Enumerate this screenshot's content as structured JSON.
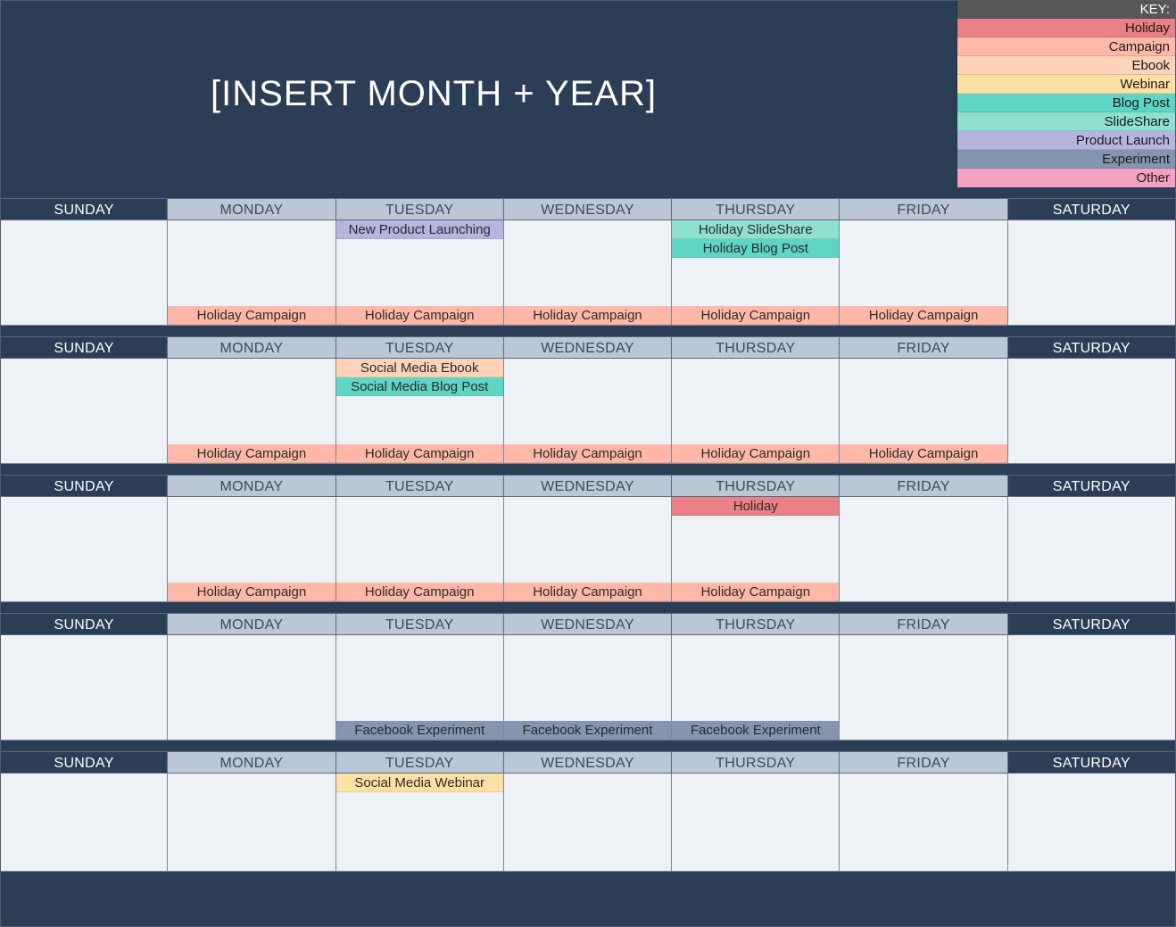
{
  "title": "[INSERT MONTH + YEAR]",
  "key_header": "KEY:",
  "legend": [
    {
      "label": "Holiday",
      "cls": "legend-holiday"
    },
    {
      "label": "Campaign",
      "cls": "legend-campaign"
    },
    {
      "label": "Ebook",
      "cls": "legend-ebook"
    },
    {
      "label": "Webinar",
      "cls": "legend-webinar"
    },
    {
      "label": "Blog Post",
      "cls": "legend-blogpost"
    },
    {
      "label": "SlideShare",
      "cls": "legend-slideshare"
    },
    {
      "label": "Product Launch",
      "cls": "legend-productlaunch"
    },
    {
      "label": "Experiment",
      "cls": "legend-experiment"
    },
    {
      "label": "Other",
      "cls": "legend-other"
    }
  ],
  "day_headers": [
    "SUNDAY",
    "MONDAY",
    "TUESDAY",
    "WEDNESDAY",
    "THURSDAY",
    "FRIDAY",
    "SATURDAY"
  ],
  "weeks": [
    {
      "days": [
        {
          "top": [],
          "bottom": []
        },
        {
          "top": [],
          "bottom": [
            {
              "label": "Holiday Campaign",
              "cls": "ev-campaign"
            }
          ]
        },
        {
          "top": [
            {
              "label": "New Product Launching",
              "cls": "ev-productlaunch"
            }
          ],
          "bottom": [
            {
              "label": "Holiday Campaign",
              "cls": "ev-campaign"
            }
          ]
        },
        {
          "top": [],
          "bottom": [
            {
              "label": "Holiday Campaign",
              "cls": "ev-campaign"
            }
          ]
        },
        {
          "top": [
            {
              "label": "Holiday SlideShare",
              "cls": "ev-slideshare"
            },
            {
              "label": "Holiday Blog Post",
              "cls": "ev-blogpost"
            }
          ],
          "bottom": [
            {
              "label": "Holiday Campaign",
              "cls": "ev-campaign"
            }
          ]
        },
        {
          "top": [],
          "bottom": [
            {
              "label": "Holiday Campaign",
              "cls": "ev-campaign"
            }
          ]
        },
        {
          "top": [],
          "bottom": []
        }
      ]
    },
    {
      "days": [
        {
          "top": [],
          "bottom": []
        },
        {
          "top": [],
          "bottom": [
            {
              "label": "Holiday Campaign",
              "cls": "ev-campaign"
            }
          ]
        },
        {
          "top": [
            {
              "label": "Social Media Ebook",
              "cls": "ev-ebook"
            },
            {
              "label": "Social Media Blog Post",
              "cls": "ev-blogpost"
            }
          ],
          "bottom": [
            {
              "label": "Holiday Campaign",
              "cls": "ev-campaign"
            }
          ]
        },
        {
          "top": [],
          "bottom": [
            {
              "label": "Holiday Campaign",
              "cls": "ev-campaign"
            }
          ]
        },
        {
          "top": [],
          "bottom": [
            {
              "label": "Holiday Campaign",
              "cls": "ev-campaign"
            }
          ]
        },
        {
          "top": [],
          "bottom": [
            {
              "label": "Holiday Campaign",
              "cls": "ev-campaign"
            }
          ]
        },
        {
          "top": [],
          "bottom": []
        }
      ]
    },
    {
      "days": [
        {
          "top": [],
          "bottom": []
        },
        {
          "top": [],
          "bottom": [
            {
              "label": "Holiday Campaign",
              "cls": "ev-campaign"
            }
          ]
        },
        {
          "top": [],
          "bottom": [
            {
              "label": "Holiday Campaign",
              "cls": "ev-campaign"
            }
          ]
        },
        {
          "top": [],
          "bottom": [
            {
              "label": "Holiday Campaign",
              "cls": "ev-campaign"
            }
          ]
        },
        {
          "top": [
            {
              "label": "Holiday",
              "cls": "ev-holiday"
            }
          ],
          "bottom": [
            {
              "label": "Holiday Campaign",
              "cls": "ev-campaign"
            }
          ]
        },
        {
          "top": [],
          "bottom": []
        },
        {
          "top": [],
          "bottom": []
        }
      ]
    },
    {
      "days": [
        {
          "top": [],
          "bottom": []
        },
        {
          "top": [],
          "bottom": []
        },
        {
          "top": [],
          "bottom": [
            {
              "label": "Facebook Experiment",
              "cls": "ev-experiment"
            }
          ]
        },
        {
          "top": [],
          "bottom": [
            {
              "label": "Facebook Experiment",
              "cls": "ev-experiment"
            }
          ]
        },
        {
          "top": [],
          "bottom": [
            {
              "label": "Facebook Experiment",
              "cls": "ev-experiment"
            }
          ]
        },
        {
          "top": [],
          "bottom": []
        },
        {
          "top": [],
          "bottom": []
        }
      ]
    },
    {
      "days": [
        {
          "top": [],
          "bottom": []
        },
        {
          "top": [],
          "bottom": []
        },
        {
          "top": [
            {
              "label": "Social Media Webinar",
              "cls": "ev-webinar"
            }
          ],
          "bottom": []
        },
        {
          "top": [],
          "bottom": []
        },
        {
          "top": [],
          "bottom": []
        },
        {
          "top": [],
          "bottom": []
        },
        {
          "top": [],
          "bottom": []
        }
      ]
    }
  ]
}
